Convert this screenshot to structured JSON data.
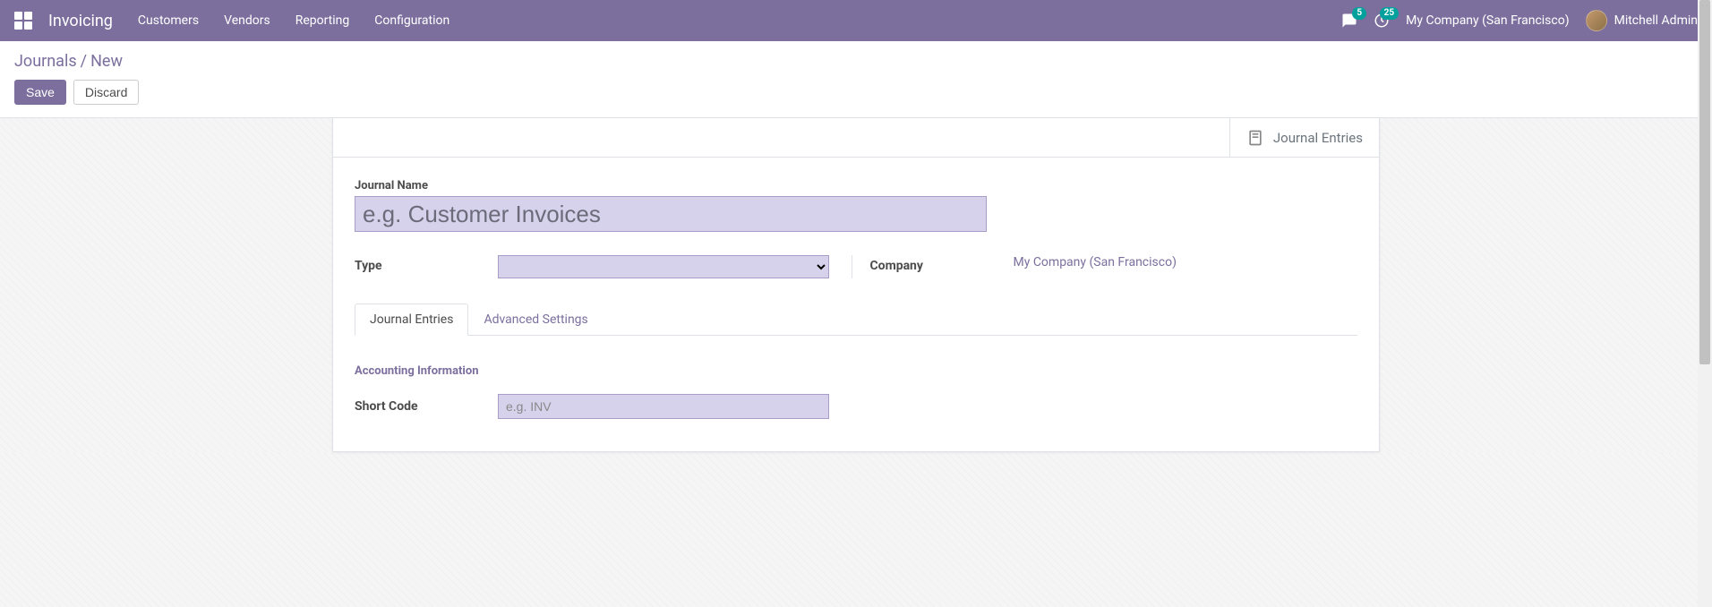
{
  "topnav": {
    "app_title": "Invoicing",
    "menu": [
      "Customers",
      "Vendors",
      "Reporting",
      "Configuration"
    ],
    "messages_badge": "5",
    "activities_badge": "25",
    "company": "My Company (San Francisco)",
    "user": "Mitchell Admin"
  },
  "breadcrumb": {
    "parent": "Journals",
    "current": "New"
  },
  "buttons": {
    "save": "Save",
    "discard": "Discard"
  },
  "stat_button": {
    "label": "Journal Entries"
  },
  "form": {
    "journal_name_label": "Journal Name",
    "journal_name_placeholder": "e.g. Customer Invoices",
    "journal_name_value": "",
    "type_label": "Type",
    "type_value": "",
    "company_label": "Company",
    "company_value": "My Company (San Francisco)"
  },
  "tabs": {
    "items": [
      "Journal Entries",
      "Advanced Settings"
    ],
    "active_index": 0
  },
  "tab_content": {
    "section_title": "Accounting Information",
    "short_code_label": "Short Code",
    "short_code_placeholder": "e.g. INV",
    "short_code_value": ""
  }
}
